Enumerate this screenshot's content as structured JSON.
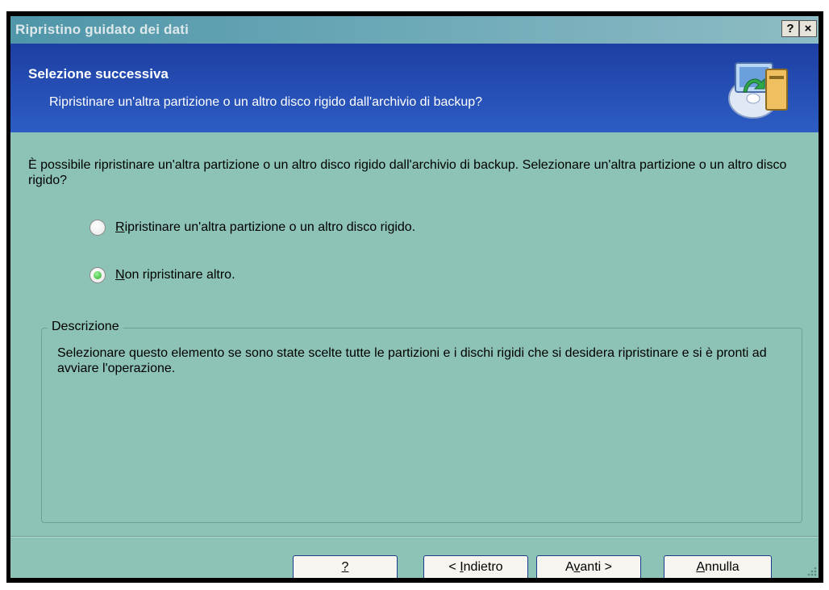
{
  "window": {
    "title": "Ripristino guidato dei dati",
    "help_button": "?",
    "close_button": "×"
  },
  "header": {
    "title": "Selezione successiva",
    "subtitle": "Ripristinare un'altra partizione o un altro disco rigido dall'archivio di backup?",
    "icon": "restore-disk-icon"
  },
  "body": {
    "intro": "È possibile ripristinare un'altra partizione o un altro disco rigido dall'archivio di backup. Selezionare un'altra partizione o un altro disco rigido?",
    "options": [
      {
        "hotkey": "R",
        "rest": "ipristinare un'altra partizione o un altro disco rigido.",
        "selected": false
      },
      {
        "hotkey": "N",
        "rest": "on ripristinare altro.",
        "selected": true
      }
    ]
  },
  "description": {
    "legend": "Descrizione",
    "text": "Selezionare questo elemento se sono state scelte tutte le partizioni e i dischi rigidi che si desidera ripristinare e si è pronti ad avviare l'operazione."
  },
  "buttons": {
    "help": "?",
    "back_prefix": "< ",
    "back_hotkey": "I",
    "back_rest": "ndietro",
    "next_prefix": "A",
    "next_hotkey": "v",
    "next_rest": "anti >",
    "cancel_hotkey": "A",
    "cancel_rest": "nnulla"
  },
  "colors": {
    "window_bg": "#8cc3b6",
    "header_bg": "#2d5dc4",
    "title_bar": "#4f96a9",
    "selected_radio": "#2aa72a"
  }
}
